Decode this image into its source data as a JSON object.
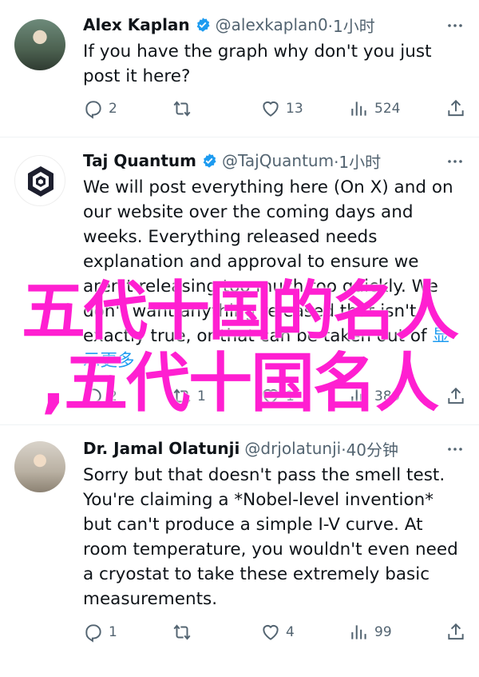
{
  "tweets": [
    {
      "name": "Alex Kaplan",
      "handle": "@alexkaplan0",
      "time": "·1小时",
      "text": "If you have the graph why don't you just post it here?",
      "replies": "2",
      "retweets": "",
      "likes": "13",
      "views": "524"
    },
    {
      "name": "Taj Quantum",
      "handle": "@TajQuantum",
      "time": "·1小时",
      "text": "We will post everything here (On X) and on our website over the coming days and weeks. Everything released needs explanation and approval to ensure we aren't releasing too much too quickly. We don't want anything released that isn't exactly true, or that can be taken out of",
      "more_link": "显示更多",
      "replies": "2",
      "retweets": "1",
      "likes": "1",
      "views": "389"
    },
    {
      "name": "Dr. Jamal Olatunji",
      "handle": "@drjolatunji",
      "time": "·40分钟",
      "text": "Sorry but that doesn't pass the smell test. You're claiming a *Nobel-level invention* but can't produce a simple I-V curve. At room temperature, you wouldn't even need a cryostat to take these extremely basic measurements.",
      "replies": "1",
      "retweets": "",
      "likes": "4",
      "views": "99"
    }
  ],
  "overlay": {
    "line1": "五代十国的名人",
    "line2": ",五代十国名人",
    "color": "#ff1fd1"
  },
  "icons": {
    "reply": "reply-icon",
    "retweet": "retweet-icon",
    "like": "heart-icon",
    "views": "views-icon",
    "share": "share-icon",
    "verified": "verified-badge-icon",
    "more": "more-icon"
  },
  "colors": {
    "text": "#0f1419",
    "secondary": "#536471",
    "link": "#1d9bf0",
    "verified": "#1d9bf0"
  }
}
